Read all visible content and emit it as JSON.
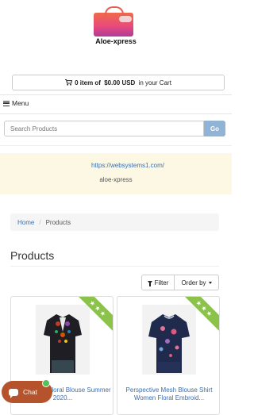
{
  "logo": {
    "text": "Aloe-xpress",
    "icon": "shopping-bag-icon"
  },
  "cart": {
    "prefix": "0 item of ",
    "amount": "$0.00 USD",
    "suffix": " in your Cart",
    "icon": "cart-icon"
  },
  "menu": {
    "label": "Menu",
    "icon": "hamburger-icon"
  },
  "search": {
    "placeholder": "Search Products",
    "button": "Go"
  },
  "banner": {
    "url": "https://websystems1.com/",
    "name": "aloe-xpress"
  },
  "breadcrumb": {
    "home": "Home",
    "separator": "/",
    "current": "Products"
  },
  "page": {
    "title": "Products"
  },
  "toolbar": {
    "filter": "Filter",
    "order": "Order by"
  },
  "products": [
    {
      "name": "Women 3D Floral Blouse Summer 2020...",
      "badge": "★★★"
    },
    {
      "name": "Perspective Mesh Blouse Shirt Women Floral Embroid...",
      "badge": "★★★"
    }
  ],
  "chat": {
    "label": "Chat"
  },
  "colors": {
    "link": "#3a6fb0",
    "go_button": "#8fb4d6",
    "banner_bg": "#fcf8e3",
    "ribbon": "#8bc34a",
    "chat": "#b5532c"
  }
}
